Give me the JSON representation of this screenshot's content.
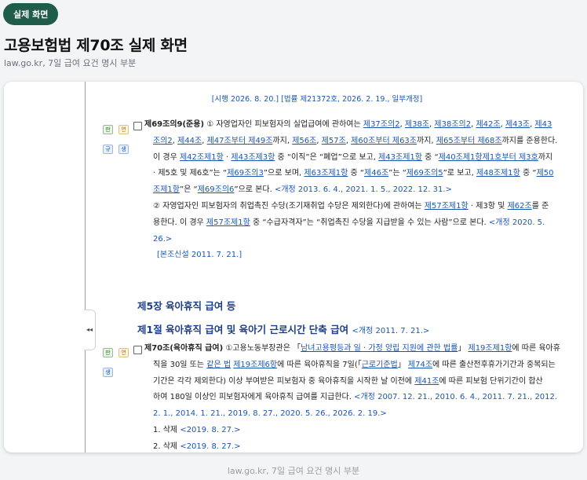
{
  "badge": "실제 화면",
  "title": "고용보험법 제70조 실제 화면",
  "subtitle": "law.go.kr, 7일 급여 요건 명시 부분",
  "footer": "law.go.kr, 7일 급여 요건 명시 부분",
  "history_line": "[시행 2026. 8. 20.] [법률 제21372호, 2026. 2. 19., 일부개정]",
  "icons": {
    "pan": "판",
    "yeon": "연",
    "gyu": "규",
    "saeng": "생",
    "collapse": "◂◂"
  },
  "art69": {
    "head": "제69조의9(준용)",
    "p1_lines": [
      [
        [
          "① 자영업자인 피보험자의 실업급여에 관하여는 ",
          ""
        ],
        [
          "제37조의2",
          "lk"
        ],
        [
          ", ",
          ""
        ],
        [
          "제38조",
          "lk"
        ],
        [
          ", ",
          ""
        ],
        [
          "제38조의2",
          "lk"
        ],
        [
          ", ",
          ""
        ],
        [
          "제42조",
          "lk"
        ],
        [
          ", ",
          ""
        ],
        [
          "제43조",
          "lk"
        ],
        [
          ", ",
          ""
        ],
        [
          "제43",
          "lk"
        ]
      ],
      [
        [
          "조의2",
          "lk"
        ],
        [
          ", ",
          ""
        ],
        [
          "제44조",
          "lk"
        ],
        [
          ", ",
          ""
        ],
        [
          "제47조부터 제49조",
          "lk"
        ],
        [
          "까지, ",
          ""
        ],
        [
          "제56조",
          "lk"
        ],
        [
          ", ",
          ""
        ],
        [
          "제57조",
          "lk"
        ],
        [
          ", ",
          ""
        ],
        [
          "제60조부터 제63조",
          "lk"
        ],
        [
          "까지, ",
          ""
        ],
        [
          "제65조부터 제68조",
          "lk"
        ],
        [
          "까지를 준용한다.",
          ""
        ]
      ],
      [
        [
          "이 경우 ",
          ""
        ],
        [
          "제42조제1항",
          "lk"
        ],
        [
          " · ",
          ""
        ],
        [
          "제43조제3항",
          "lk"
        ],
        [
          " 중 “이직”은 “폐업”으로 보고, ",
          ""
        ],
        [
          "제43조제1항",
          "lk"
        ],
        [
          " 중 “",
          ""
        ],
        [
          "제40조제1항제1호부터 제3호",
          "lk"
        ],
        [
          "까지",
          ""
        ]
      ],
      [
        [
          " · 제5호 및 제6호”는 “",
          ""
        ],
        [
          "제69조의3",
          "lk"
        ],
        [
          "”으로 보며, ",
          ""
        ],
        [
          "제63조제1항",
          "lk"
        ],
        [
          " 중 “",
          ""
        ],
        [
          "제46조",
          "lk"
        ],
        [
          "”는 “",
          ""
        ],
        [
          "제69조의5",
          "lk"
        ],
        [
          "”로 보고, ",
          ""
        ],
        [
          "제48조제1항",
          "lk"
        ],
        [
          " 중 “",
          ""
        ],
        [
          "제50",
          "lk"
        ]
      ],
      [
        [
          "조제1항",
          "lk"
        ],
        [
          "”은 “",
          ""
        ],
        [
          "제69조의6",
          "lk"
        ],
        [
          "”으로 본다. ",
          ""
        ],
        [
          "<개정 2013. 6. 4., 2021. 1. 5., 2022. 12. 31.>",
          "nb"
        ]
      ]
    ],
    "p2_lines": [
      [
        [
          "② 자영업자인 피보험자의 취업촉진 수당(조기재취업 수당은 제외한다)에 관하여는 ",
          ""
        ],
        [
          "제57조제1항",
          "lk"
        ],
        [
          " · 제3항 및 ",
          ""
        ],
        [
          "제62조",
          "lk"
        ],
        [
          "를 준",
          ""
        ]
      ],
      [
        [
          "용한다. 이 경우 ",
          ""
        ],
        [
          "제57조제1항",
          "lk"
        ],
        [
          " 중 “수급자격자”는 “취업촉진 수당을 지급받을 수 있는 사람”으로 본다.  ",
          ""
        ],
        [
          "<개정 2020. 5.",
          "nb"
        ]
      ],
      [
        [
          "26.>",
          "nb"
        ]
      ]
    ],
    "new_note": "[본조신설 2011. 7. 21.]"
  },
  "chapter5": "제5장 육아휴직 급여 등",
  "section1": {
    "text": "제1절 육아휴직 급여 및 육아기 근로시간 단축 급여",
    "note": "<개정 2011. 7. 21.>"
  },
  "art70": {
    "head": "제70조(육아휴직 급여)",
    "lines": [
      [
        [
          "①고용노동부장관은 「",
          ""
        ],
        [
          "남녀고용평등과 일 · 가정 양립 지원에 관한 법률",
          "lk"
        ],
        [
          "」 ",
          ""
        ],
        [
          "제19조제1항",
          "lk"
        ],
        [
          "에 따른 육아휴",
          ""
        ]
      ],
      [
        [
          "직을 30일 또는 ",
          ""
        ],
        [
          "같은 법",
          "lk"
        ],
        [
          " ",
          ""
        ],
        [
          "제19조제6항",
          "lk"
        ],
        [
          "에 따른 육아휴직을 7일(「",
          ""
        ],
        [
          "근로기준법",
          "lk"
        ],
        [
          "」 ",
          ""
        ],
        [
          "제74조",
          "lk"
        ],
        [
          "에 따른 출산전후휴가기간과 중복되는",
          ""
        ]
      ],
      [
        [
          "기간은 각각 제외한다) 이상 부여받은 피보험자 중 육아휴직을 시작한 날 이전에 ",
          ""
        ],
        [
          "제41조",
          "lk"
        ],
        [
          "에 따른 피보험 단위기간이 합산",
          ""
        ]
      ],
      [
        [
          "하여 180일 이상인 피보험자에게 육아휴직 급여를 지급한다. ",
          ""
        ],
        [
          "<개정 2007. 12. 21., 2010. 6. 4., 2011. 7. 21., 2012.",
          "nb"
        ]
      ],
      [
        [
          "2. 1., 2014. 1. 21., 2019. 8. 27., 2020. 5. 26., 2026. 2. 19.>",
          "nb"
        ]
      ]
    ],
    "items": [
      {
        "label": "1. 삭제 ",
        "note": "<2019. 8. 27.>"
      },
      {
        "label": "2. 삭제 ",
        "note": "<2019. 8. 27.>"
      }
    ]
  },
  "colors": {
    "link": "#1a56b0",
    "badge_bg": "#1f5c4a",
    "heading_blue": "#1b3f8a"
  }
}
